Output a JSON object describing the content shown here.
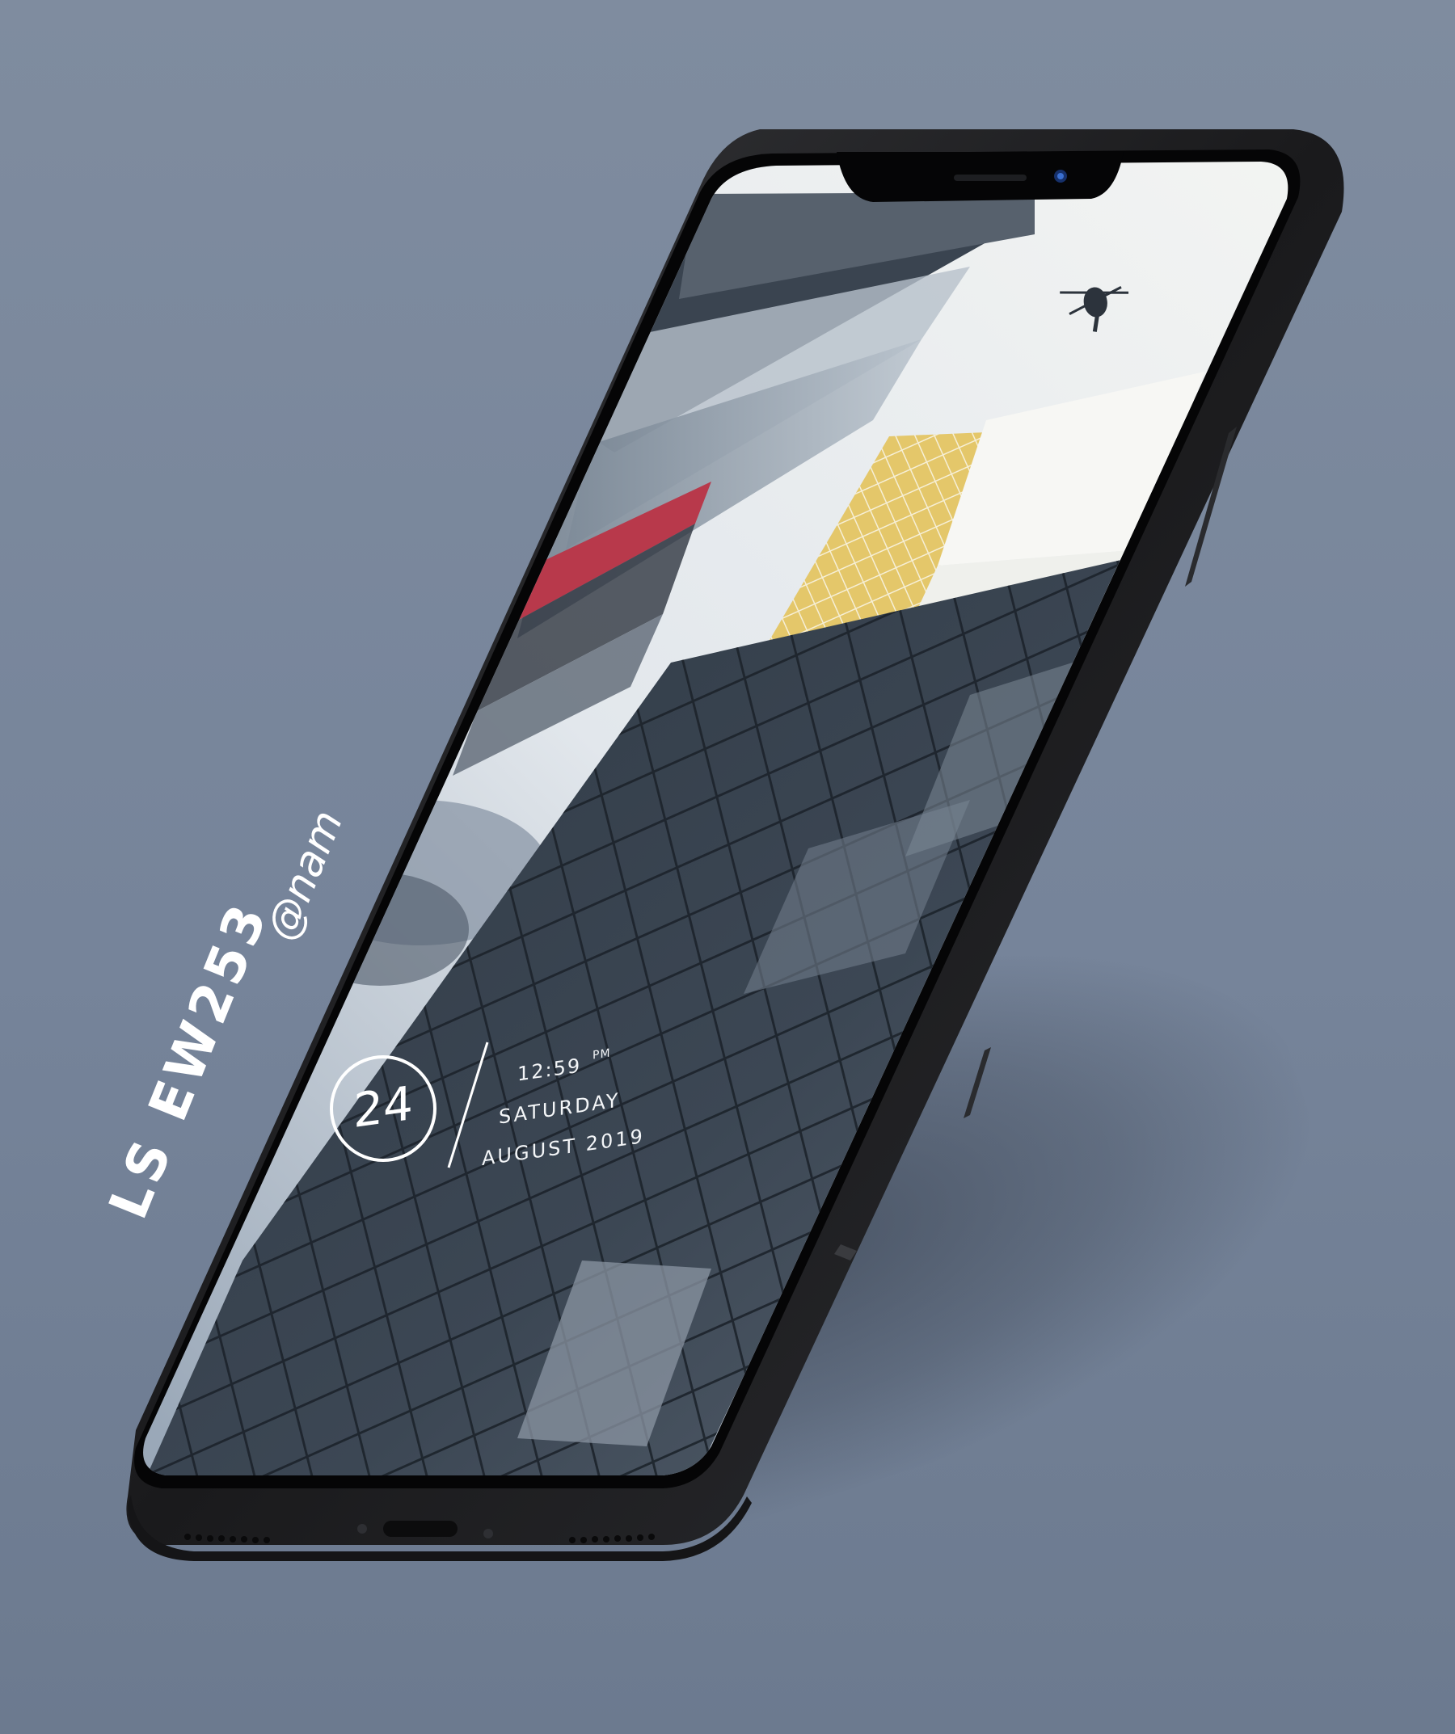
{
  "lockscreen": {
    "day_number": "24",
    "time": "12:59",
    "ampm": "PM",
    "weekday": "SATURDAY",
    "month_year": "AUGUST 2019"
  },
  "credits": {
    "title": "LS EW253",
    "handle": "@nam"
  },
  "colors": {
    "background": "#7a879b",
    "phone_frame": "#1c1c1e",
    "widget_text": "#ffffff"
  },
  "icons": {
    "helicopter": "helicopter-icon"
  }
}
